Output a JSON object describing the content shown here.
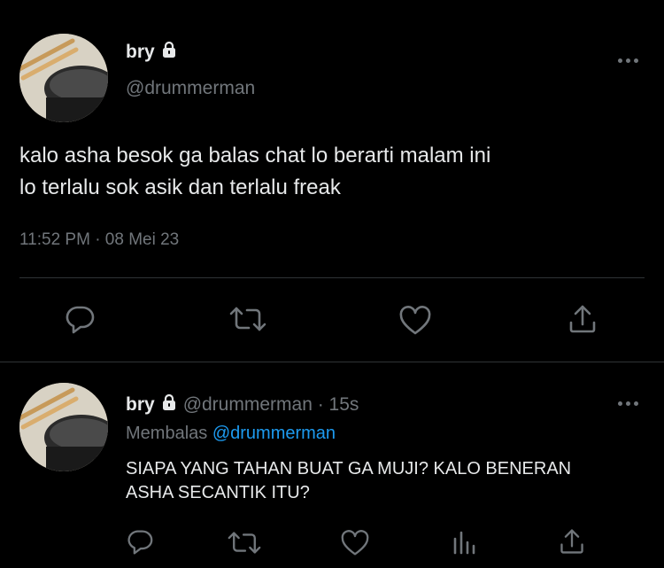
{
  "main_tweet": {
    "display_name": "bry",
    "handle": "@drummerman",
    "text_line1": "kalo asha besok ga balas chat lo berarti malam ini",
    "text_line2": "lo terlalu sok asik dan terlalu freak",
    "timestamp": "11:52 PM · 08 Mei 23",
    "icons": [
      "reply-icon",
      "retweet-icon",
      "like-icon",
      "share-icon"
    ]
  },
  "reply_tweet": {
    "display_name": "bry",
    "handle_time": "@drummerman · 15s",
    "replying_prefix": "Membalas",
    "replying_handle": "@drummerman",
    "text_line1": "SIAPA YANG TAHAN BUAT GA MUJI? KALO BENERAN",
    "text_line2": "ASHA SECANTIK ITU?",
    "icons": [
      "reply-icon",
      "retweet-icon",
      "like-icon",
      "views-icon",
      "share-icon"
    ]
  },
  "colors": {
    "background": "#000000",
    "text": "#e7e9ea",
    "muted": "#71767b",
    "accent": "#1d9bf0",
    "divider": "#2f3336"
  }
}
